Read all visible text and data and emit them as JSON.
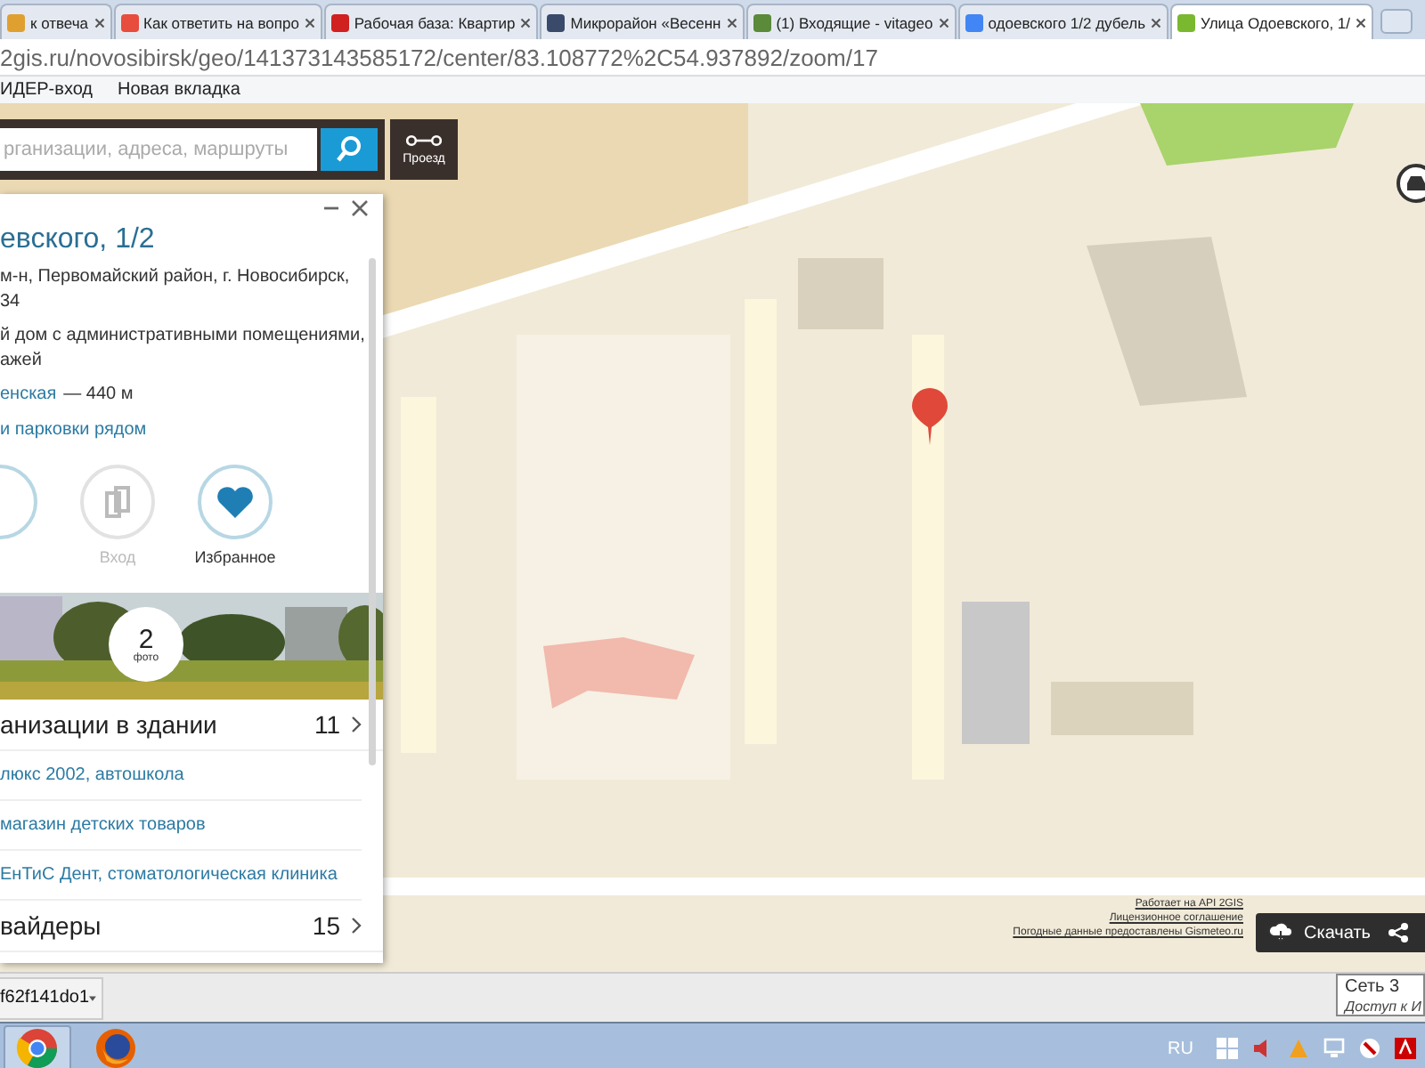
{
  "browser": {
    "tabs": [
      {
        "title": "к отвеча",
        "selected": false,
        "color": "#e0a030"
      },
      {
        "title": "Как ответить на вопро",
        "selected": false,
        "color": "#e84c3d"
      },
      {
        "title": "Рабочая база: Квартир",
        "selected": false,
        "color": "#d02020"
      },
      {
        "title": "Микрорайон «Весенн",
        "selected": false,
        "color": "#3a4a6a"
      },
      {
        "title": "(1) Входящие - vitageo",
        "selected": false,
        "color": "#5a8a3a"
      },
      {
        "title": "одоевского 1/2 дубель",
        "selected": false,
        "color": "#4285f4"
      },
      {
        "title": "Улица Одоевского, 1/",
        "selected": true,
        "color": "#7ab830"
      }
    ],
    "address": "2gis.ru/novosibirsk/geo/141373143585172/center/83.108772%2C54.937892/zoom/17",
    "bookmarks": [
      "ИДЕР-вход",
      "Новая вкладка"
    ]
  },
  "search": {
    "placeholder": "рганизации, адреса, маршруты"
  },
  "route_button": "Проезд",
  "card": {
    "title": "евского, 1/2",
    "address_lines": [
      "м-н, Первомайский район, г. Новосибирск,",
      "34"
    ],
    "description_lines": [
      "й дом с административными помещениями,",
      "ажей"
    ],
    "metro": {
      "station": "енская",
      "distance": "— 440 м"
    },
    "parking_link": "и парковки рядом",
    "actions": [
      {
        "label": "Вход",
        "disabled": true
      },
      {
        "label": "Избранное",
        "disabled": false
      }
    ],
    "photos": {
      "count": "2",
      "label": "фото"
    },
    "sections": [
      {
        "title": "анизации в здании",
        "count": "11",
        "items": [
          "люкс 2002, автошкола",
          "магазин детских товаров",
          "ЕнТиС Дент, стоматологическая клиника"
        ]
      },
      {
        "title": "вайдеры",
        "count": "15"
      }
    ]
  },
  "attribution": [
    "Работает на API 2GIS",
    "Лицензионное соглашение",
    "Погодные данные предоставлены Gismeteo.ru"
  ],
  "download_button": "Скачать",
  "downloads": {
    "file": "f62f141do1"
  },
  "taskbar": {
    "language": "RU"
  },
  "tooltip": {
    "title": "Сеть 3",
    "text": "Доступ к И"
  }
}
